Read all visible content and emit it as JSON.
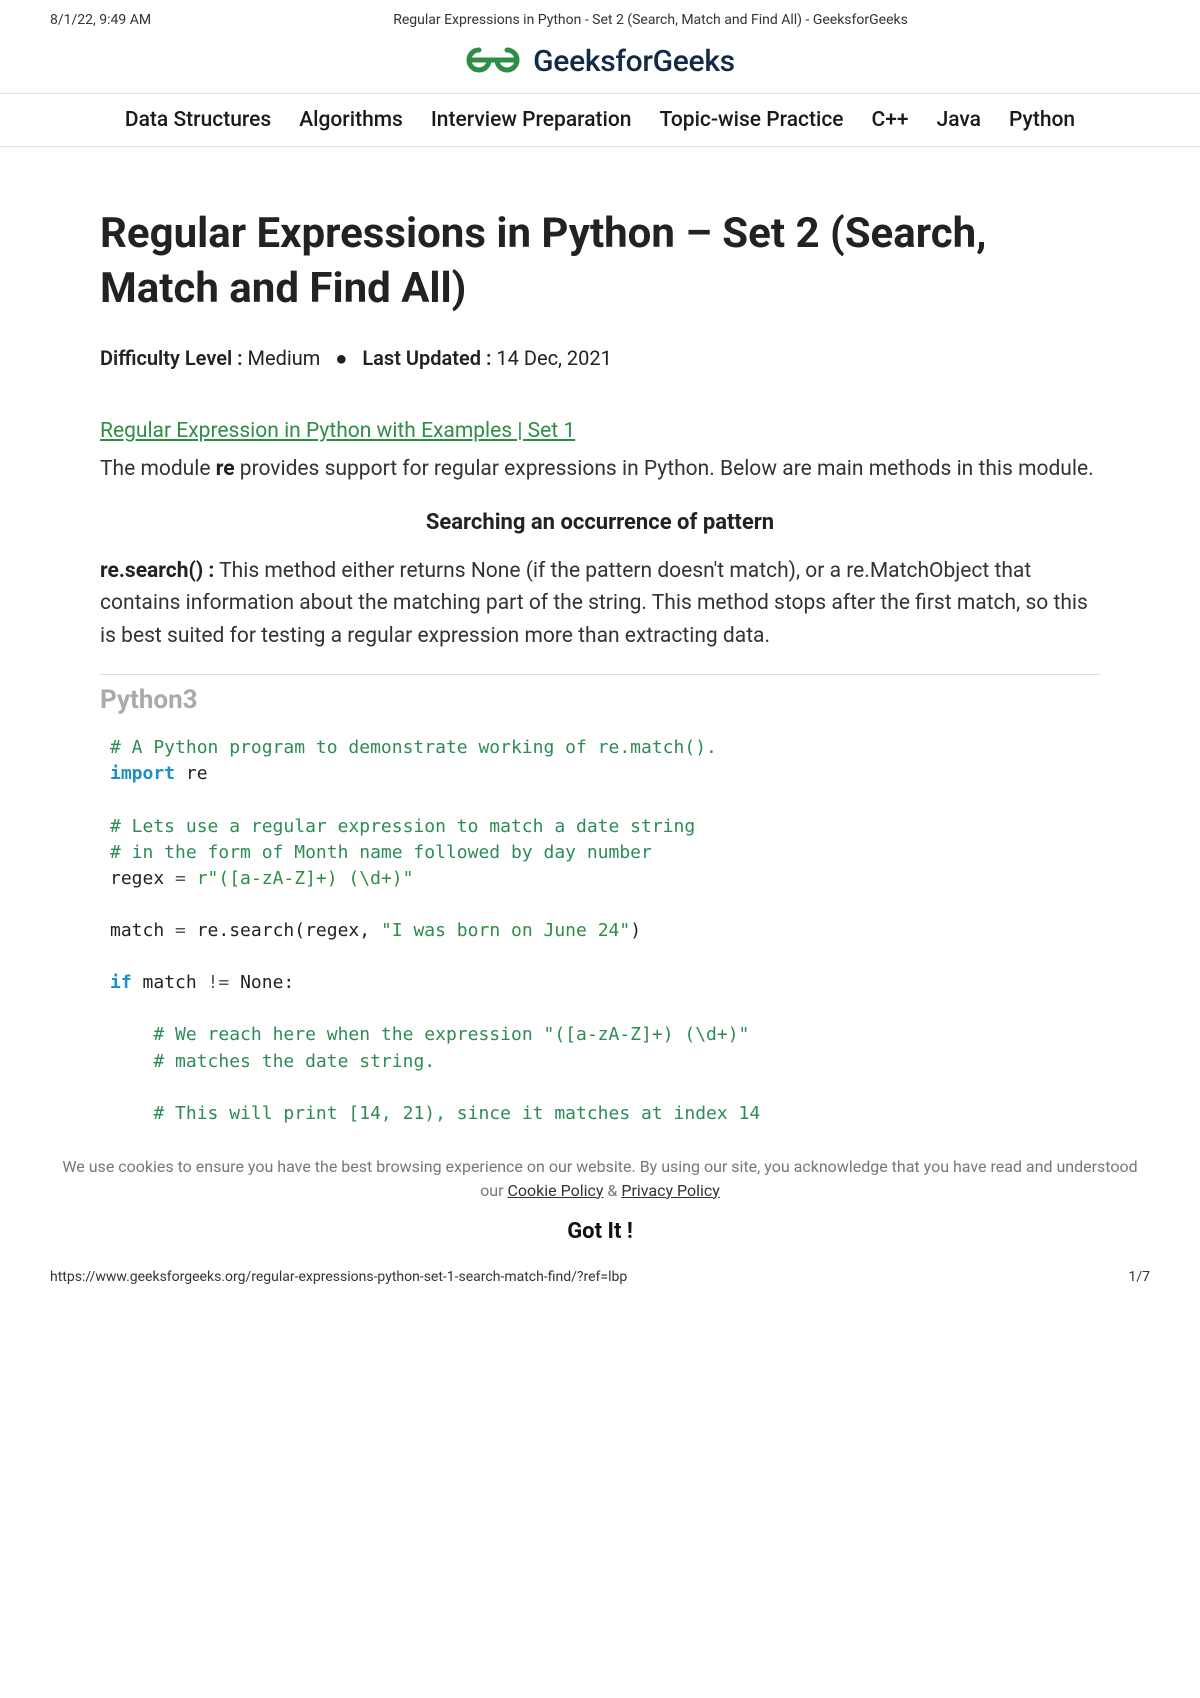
{
  "print": {
    "timestamp": "8/1/22, 9:49 AM",
    "title": "Regular Expressions in Python - Set 2 (Search, Match and Find All) - GeeksforGeeks",
    "url": "https://www.geeksforgeeks.org/regular-expressions-python-set-1-search-match-find/?ref=lbp",
    "page": "1/7"
  },
  "brand": {
    "name": "GeeksforGeeks"
  },
  "nav": {
    "items": [
      "Data Structures",
      "Algorithms",
      "Interview Preparation",
      "Topic-wise Practice",
      "C++",
      "Java",
      "Python"
    ]
  },
  "article": {
    "title": "Regular Expressions in Python – Set 2 (Search, Match and Find All)",
    "difficulty_label": "Difficulty Level :",
    "difficulty_value": " Medium",
    "updated_label": "Last Updated :",
    "updated_value": " 14 Dec, 2021",
    "link_text": "Regular Expression in Python with Examples | Set 1",
    "intro_prefix": "The module ",
    "intro_bold": "re",
    "intro_suffix": " provides support for regular expressions in Python. Below are main methods in this module.",
    "subhead": "Searching an occurrence of pattern",
    "search_bold": "re.search() :",
    "search_text": " This method either returns None (if the pattern doesn't match), or a re.MatchObject that contains information about the matching part of the string. This method stops after the first match, so this is best suited for testing a regular expression more than extracting data.",
    "code_lang": "Python3",
    "code": {
      "c1": "# A Python program to demonstrate working of re.match().",
      "kw_import": "import",
      "mod_re": " re",
      "c2": "# Lets use a regular expression to match a date string",
      "c3": "# in the form of Month name followed by day number",
      "lhs_regex": "regex ",
      "eq": "=",
      "str_regex": " r\"([a-zA-Z]+) (\\d+)\"",
      "lhs_match": "match ",
      "call_search": " re.search(regex, ",
      "str_born": "\"I was born on June 24\"",
      "paren_close": ")",
      "kw_if": "if",
      "cond": " match ",
      "neq": "!=",
      "none": " None:",
      "c4": "# We reach here when the expression \"([a-zA-Z]+) (\\d+)\"",
      "c5": "# matches the date string.",
      "c6": "# This will print [14, 21), since it matches at index 14"
    }
  },
  "cookie": {
    "text_a": "We use cookies to ensure you have the best browsing experience on our website. By using our site, you acknowledge that you have read and understood our ",
    "policy1": "Cookie Policy",
    "amp": " & ",
    "policy2": "Privacy Policy",
    "gotit": "Got It !"
  }
}
